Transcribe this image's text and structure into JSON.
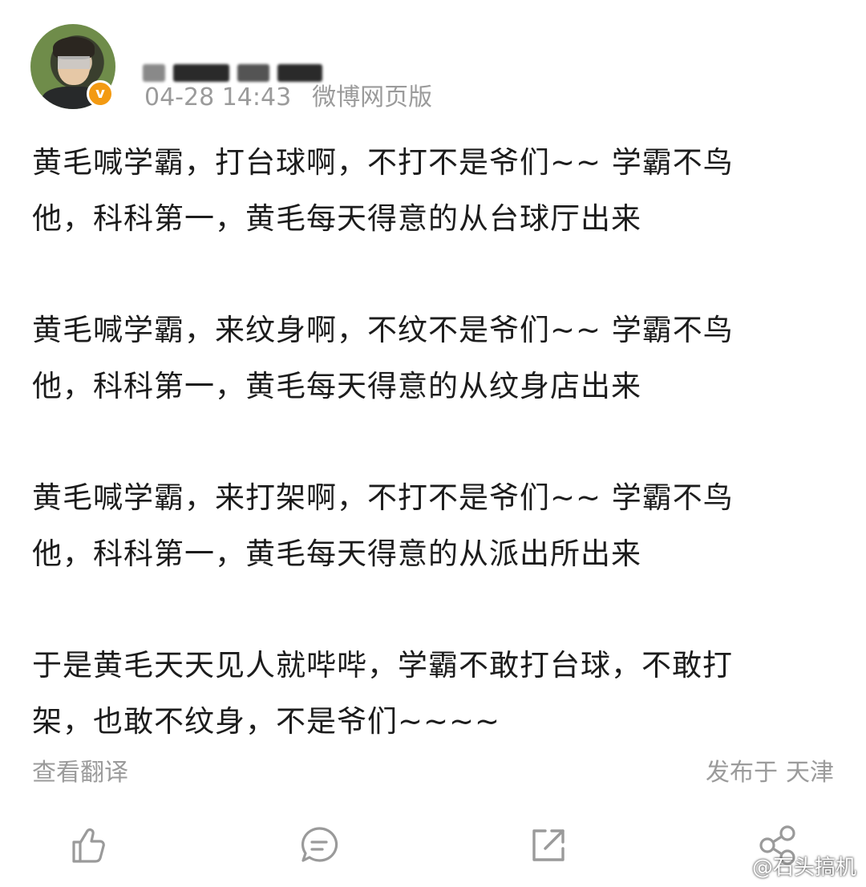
{
  "post": {
    "author": {
      "name_obscured": true,
      "verified_badge": "v"
    },
    "time": "04-28 14:43",
    "source": "微博网页版",
    "paragraphs": [
      {
        "line1": "黄毛喊学霸，打台球啊，不打不是爷们~~ 学霸不鸟",
        "line2": "他，科科第一，黄毛每天得意的从台球厅出来"
      },
      {
        "line1": "黄毛喊学霸，来纹身啊，不纹不是爷们~~ 学霸不鸟",
        "line2": "他，科科第一，黄毛每天得意的从纹身店出来"
      },
      {
        "line1": "黄毛喊学霸，来打架啊，不打不是爷们~~ 学霸不鸟",
        "line2": "他，科科第一，黄毛每天得意的从派出所出来"
      },
      {
        "line1": "于是黄毛天天见人就哔哔，学霸不敢打台球，不敢打",
        "line2": "架，也敢不纹身，不是爷们~~~~"
      }
    ],
    "translate_label": "查看翻译",
    "published_prefix": "发布于",
    "published_location": "天津"
  },
  "actions": [
    {
      "icon": "like-icon"
    },
    {
      "icon": "comment-icon"
    },
    {
      "icon": "repost-icon"
    },
    {
      "icon": "share-icon"
    }
  ],
  "watermark": "@石头搞机",
  "colors": {
    "text": "#1c1c1c",
    "meta": "#9b9b9b",
    "verified": "#f39a12",
    "icon": "#9a9a9a"
  }
}
